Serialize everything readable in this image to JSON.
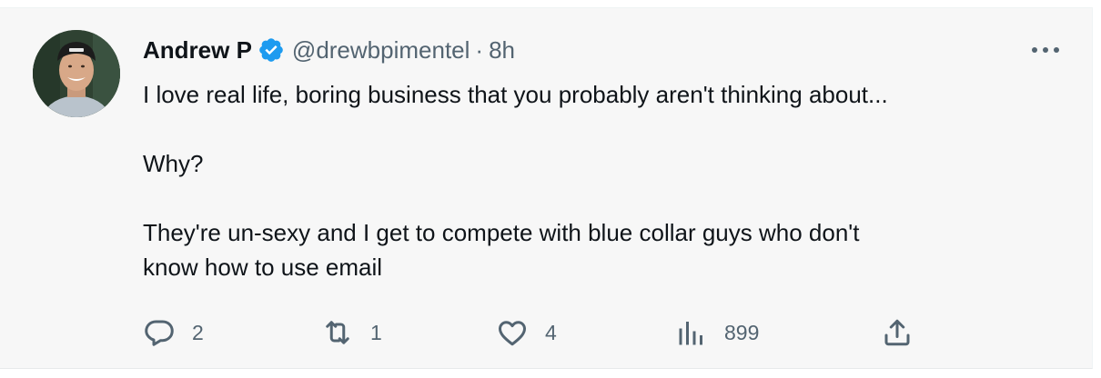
{
  "tweet": {
    "author_name": "Andrew P",
    "handle": "@drewbpimentel",
    "separator": "·",
    "time": "8h",
    "text_lines": [
      "I love real life, boring business that you probably aren't thinking about...",
      "Why?",
      "They're un-sexy and I get to compete with blue collar guys who don't",
      "know how to use email"
    ],
    "verified": true
  },
  "actions": {
    "replies": "2",
    "retweets": "1",
    "likes": "4",
    "views": "899"
  },
  "icons": {
    "verified": "verified-badge-icon",
    "more": "more-horizontal-icon",
    "reply": "reply-icon",
    "retweet": "retweet-icon",
    "like": "heart-icon",
    "views": "views-chart-icon",
    "share": "share-icon"
  },
  "colors": {
    "verified_blue": "#1d9bf0",
    "secondary_text": "#536471",
    "primary_text": "#0f1419",
    "background": "#f7f7f7"
  }
}
